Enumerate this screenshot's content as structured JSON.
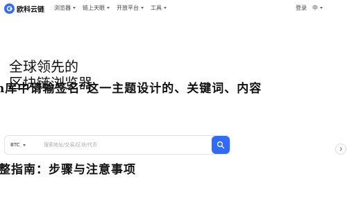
{
  "brand": {
    "name": "欧科云链",
    "color": "#2f6bff",
    "logo_icon": "okx-chain-logo"
  },
  "nav": {
    "items": [
      {
        "label": "浏览器",
        "has_dropdown": true
      },
      {
        "label": "链上天眼",
        "has_dropdown": true
      },
      {
        "label": "开放平台",
        "has_dropdown": true
      },
      {
        "label": "工具",
        "has_dropdown": true
      }
    ],
    "right_items": [
      {
        "label": "登录",
        "has_dropdown": false
      },
      {
        "label": "中",
        "has_dropdown": true
      }
    ]
  },
  "hero": {
    "title": "全球领先的\n区块链浏览器"
  },
  "overlay": {
    "line1": "n库中请输签名\"这一主题设计的、关键词、内容",
    "line2": "整指南：步骤与注意事项"
  },
  "search": {
    "chain": "BTC",
    "placeholder": "搜索地址/交易/区块/代币",
    "button_icon": "search-icon"
  },
  "side": {
    "icon": "chevron-right-icon"
  }
}
